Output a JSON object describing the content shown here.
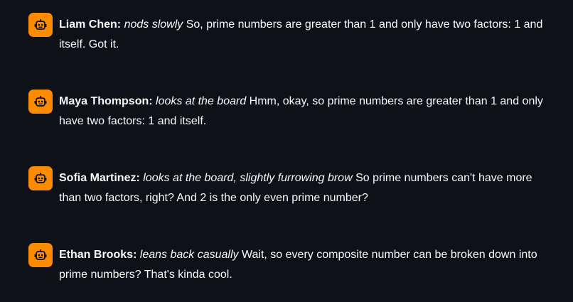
{
  "theme": {
    "background": "#0e1117",
    "text": "#fafafa",
    "avatar_bg": "#ff8c00",
    "avatar_icon": "robot-icon"
  },
  "messages": [
    {
      "name": "Liam Chen:",
      "action": "nods slowly",
      "text": "So, prime numbers are greater than 1 and only have two factors: 1 and itself. Got it."
    },
    {
      "name": "Maya Thompson:",
      "action": "looks at the board",
      "text": "Hmm, okay, so prime numbers are greater than 1 and only have two factors: 1 and itself."
    },
    {
      "name": "Sofia Martinez:",
      "action": "looks at the board, slightly furrowing brow",
      "text": "So prime numbers can't have more than two factors, right? And 2 is the only even prime number?"
    },
    {
      "name": "Ethan Brooks:",
      "action": "leans back casually",
      "text": "Wait, so every composite number can be broken down into prime numbers? That's kinda cool."
    }
  ]
}
